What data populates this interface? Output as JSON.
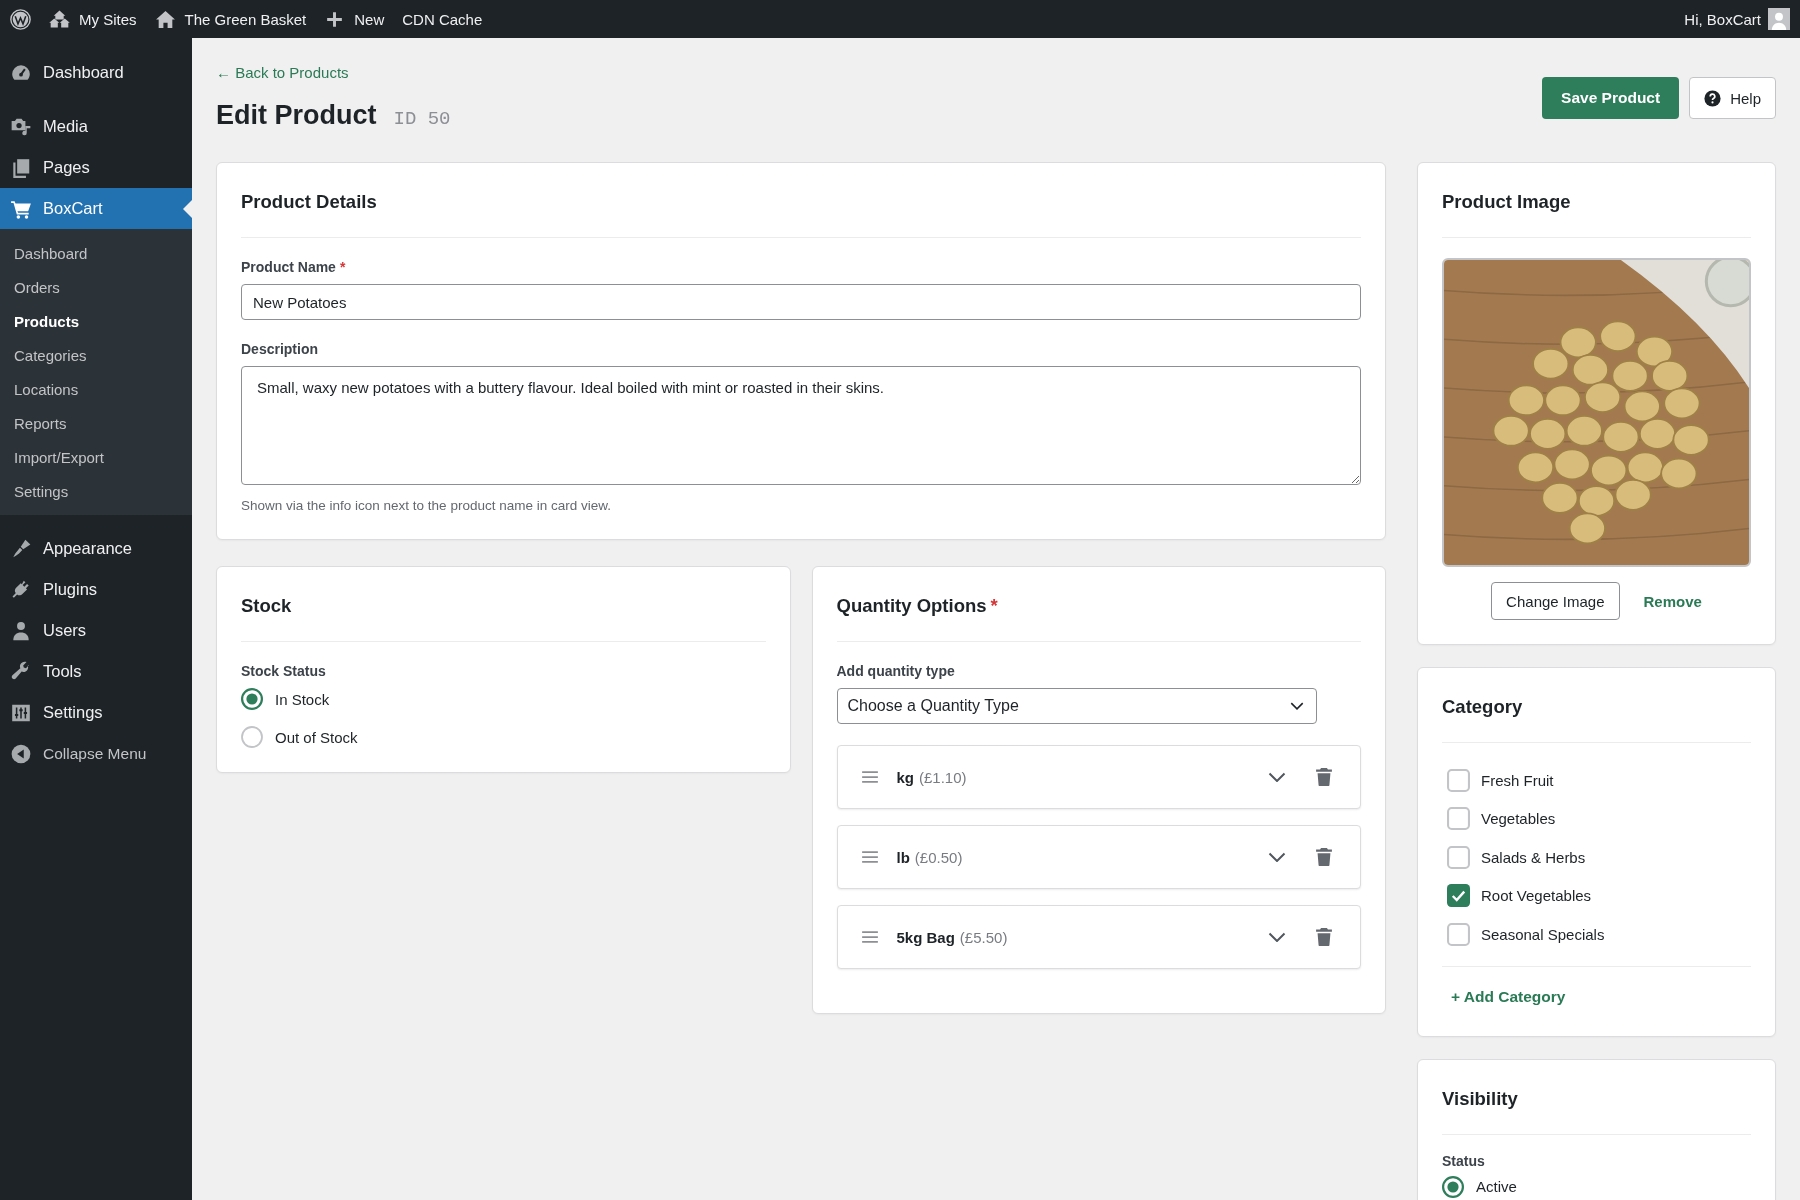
{
  "admin_bar": {
    "links": [
      {
        "label": "My Sites"
      },
      {
        "label": "The Green Basket"
      },
      {
        "label": "New"
      },
      {
        "label": "CDN Cache"
      }
    ],
    "greeting": "Hi, BoxCart"
  },
  "sidebar": {
    "sections": [
      {
        "items": [
          {
            "label": "Dashboard",
            "selected": false
          }
        ]
      },
      {
        "items": [
          {
            "label": "Media",
            "selected": false
          },
          {
            "label": "Pages",
            "selected": false
          },
          {
            "label": "BoxCart",
            "selected": true,
            "children": [
              {
                "label": "Dashboard",
                "selected": false
              },
              {
                "label": "Orders",
                "selected": false
              },
              {
                "label": "Products",
                "selected": true
              },
              {
                "label": "Categories",
                "selected": false
              },
              {
                "label": "Locations",
                "selected": false
              },
              {
                "label": "Reports",
                "selected": false
              },
              {
                "label": "Import/Export",
                "selected": false
              },
              {
                "label": "Settings",
                "selected": false
              }
            ]
          }
        ]
      },
      {
        "items": [
          {
            "label": "Appearance",
            "selected": false
          },
          {
            "label": "Plugins",
            "selected": false
          },
          {
            "label": "Users",
            "selected": false
          },
          {
            "label": "Tools",
            "selected": false
          },
          {
            "label": "Settings",
            "selected": false
          }
        ]
      }
    ],
    "collapse": "Collapse Menu"
  },
  "header": {
    "back_link": "← Back to Products",
    "title": "Edit Product",
    "id": "ID 50",
    "buttons": [
      {
        "label": "Save Product",
        "kind": "primary"
      },
      {
        "label": "Help",
        "kind": "help"
      }
    ]
  },
  "product_details": {
    "title": "Product Details",
    "fields": [
      {
        "kind": "input",
        "label": "Product Name",
        "required_mark": "*",
        "value": "New Potatoes"
      },
      {
        "kind": "textarea",
        "label": "Description",
        "value": "Small, waxy new potatoes with a buttery flavour. Ideal boiled with mint or roasted in their skins."
      }
    ],
    "help_text": "Shown via the info icon next to the product name in card view."
  },
  "stock": {
    "title": "Stock",
    "group_label": "Stock Status",
    "options": [
      {
        "label": "In Stock",
        "selected": true
      },
      {
        "label": "Out of Stock",
        "selected": false
      }
    ]
  },
  "quantity_options": {
    "title": "Quantity Options",
    "required_mark": "*",
    "select_label": "Add quantity type",
    "select_value": "Choose a Quantity Type",
    "items": [
      {
        "name": "kg",
        "price": "(£1.10)"
      },
      {
        "name": "lb",
        "price": "(£0.50)"
      },
      {
        "name": "5kg Bag",
        "price": "(£5.50)"
      }
    ]
  },
  "product_image": {
    "title": "Product Image",
    "change_button": "Change Image",
    "remove_link": "Remove"
  },
  "category": {
    "title": "Category",
    "options": [
      {
        "label": "Fresh Fruit",
        "checked": false
      },
      {
        "label": "Vegetables",
        "checked": false
      },
      {
        "label": "Salads & Herbs",
        "checked": false
      },
      {
        "label": "Root Vegetables",
        "checked": true
      },
      {
        "label": "Seasonal Specials",
        "checked": false
      }
    ],
    "add_link": "+ Add Category"
  },
  "visibility": {
    "title": "Visibility",
    "group_label": "Status",
    "options": [
      {
        "label": "Active",
        "selected": true
      }
    ]
  }
}
